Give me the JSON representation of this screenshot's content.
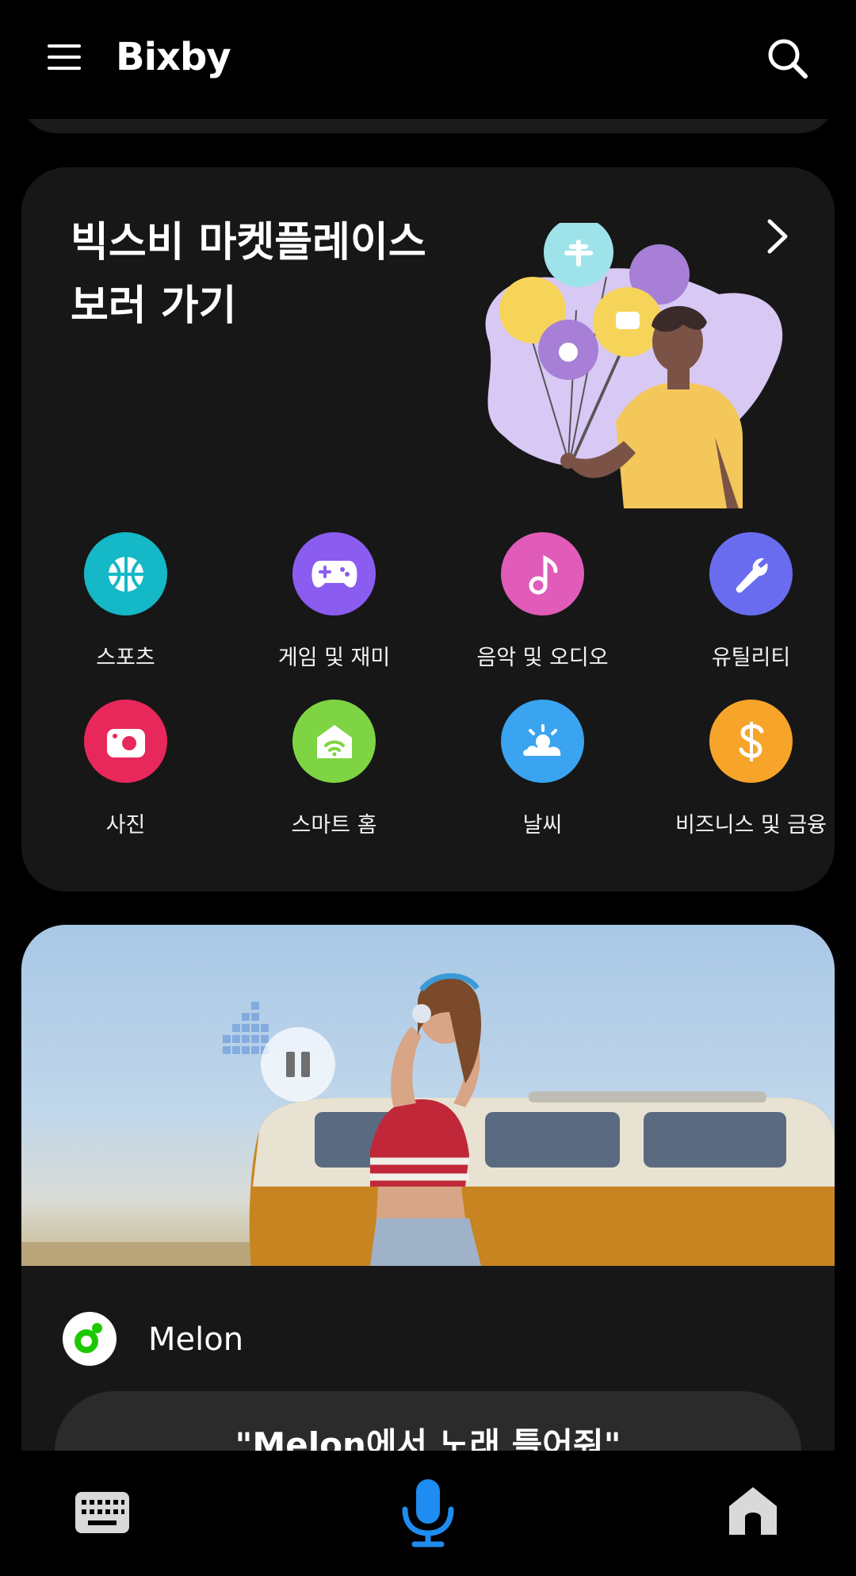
{
  "header": {
    "title": "Bixby",
    "menu_icon": "hamburger-menu-icon",
    "search_icon": "search-icon"
  },
  "marketplace": {
    "title": "빅스비 마켓플레이스\n보러 가기",
    "chevron_icon": "chevron-right-icon",
    "categories": [
      {
        "label": "스포츠",
        "icon": "basketball-icon",
        "color": "#14b8c6"
      },
      {
        "label": "게임 및 재미",
        "icon": "gamepad-icon",
        "color": "#8a5cf0"
      },
      {
        "label": "음악 및 오디오",
        "icon": "music-note-icon",
        "color": "#e05cb8"
      },
      {
        "label": "유틸리티",
        "icon": "wrench-icon",
        "color": "#6a6cf0"
      },
      {
        "label": "사진",
        "icon": "camera-icon",
        "color": "#e8285a"
      },
      {
        "label": "스마트 홈",
        "icon": "smart-home-icon",
        "color": "#7ed442"
      },
      {
        "label": "날씨",
        "icon": "weather-icon",
        "color": "#3aa4f0"
      },
      {
        "label": "비즈니스 및 금융",
        "icon": "dollar-icon",
        "color": "#f7a42a"
      }
    ]
  },
  "melon": {
    "name": "Melon",
    "suggestion": "\"Melon에서 노래 틀어줘\"",
    "brand_color": "#1ec800"
  },
  "bottom_bar": {
    "keyboard_icon": "keyboard-icon",
    "mic_icon": "microphone-icon",
    "home_icon": "home-icon",
    "mic_color": "#1e8cf0"
  }
}
